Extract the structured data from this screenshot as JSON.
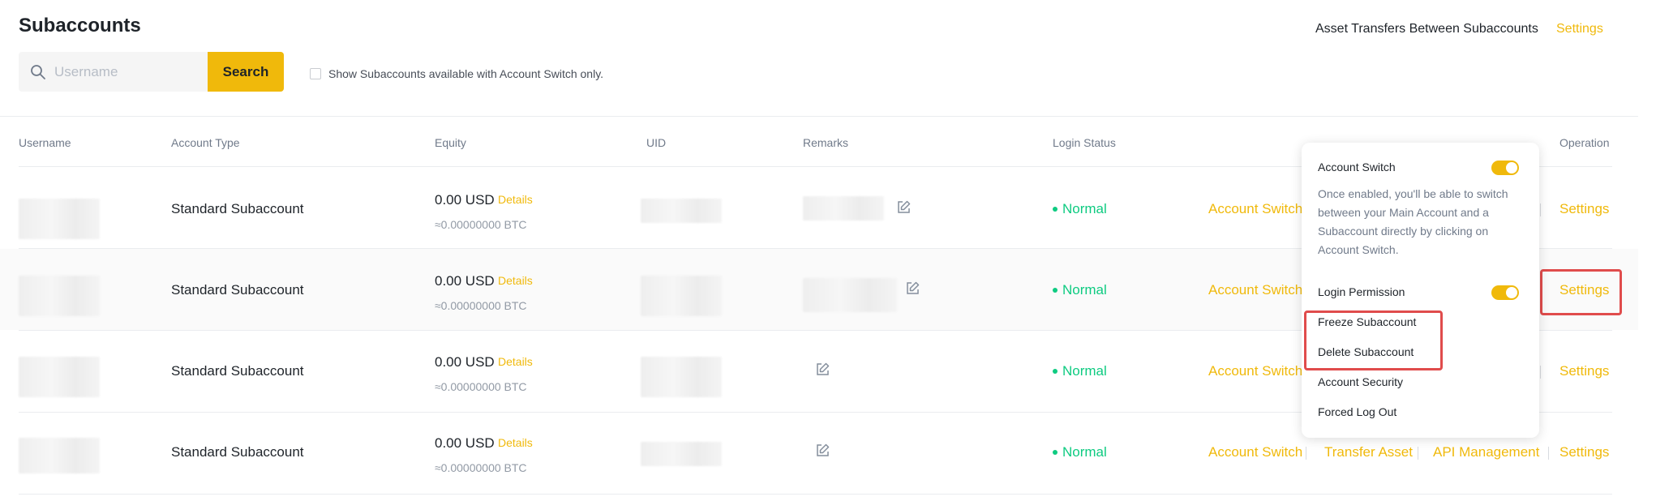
{
  "header": {
    "title": "Subaccounts",
    "transfer_label": "Asset Transfers Between Subaccounts",
    "transfer_settings": "Settings"
  },
  "search": {
    "placeholder": "Username",
    "button_label": "Search",
    "filter_label": "Show Subaccounts available with Account Switch only."
  },
  "table": {
    "columns": [
      "Username",
      "Account Type",
      "Equity",
      "UID",
      "Remarks",
      "Login Status",
      "Operation"
    ],
    "rows": [
      {
        "account_type": "Standard Subaccount",
        "equity": "0.00 USD",
        "details": "Details",
        "btc": "≈0.00000000 BTC",
        "status": "Normal",
        "op_account_switch": "Account Switch",
        "op_settings": "Settings"
      },
      {
        "account_type": "Standard Subaccount",
        "equity": "0.00 USD",
        "details": "Details",
        "btc": "≈0.00000000 BTC",
        "status": "Normal",
        "op_account_switch": "Account Switch",
        "op_settings": "Settings"
      },
      {
        "account_type": "Standard Subaccount",
        "equity": "0.00 USD",
        "details": "Details",
        "btc": "≈0.00000000 BTC",
        "status": "Normal",
        "op_account_switch": "Account Switch",
        "op_settings": "Settings"
      },
      {
        "account_type": "Standard Subaccount",
        "equity": "0.00 USD",
        "details": "Details",
        "btc": "≈0.00000000 BTC",
        "status": "Normal",
        "op_account_switch": "Account Switch",
        "op_transfer": "Transfer Asset",
        "op_api": "API Management",
        "op_settings": "Settings"
      }
    ]
  },
  "popup": {
    "account_switch_label": "Account Switch",
    "account_switch_desc": "Once enabled, you'll be able to switch between your Main Account and a Subaccount directly by clicking on Account Switch.",
    "login_permission_label": "Login Permission",
    "freeze_label": "Freeze Subaccount",
    "delete_label": "Delete Subaccount",
    "security_label": "Account Security",
    "logout_label": "Forced Log Out"
  },
  "colors": {
    "accent": "#f0b90b",
    "status_normal": "#0ecb81",
    "highlight": "#e04c4c"
  },
  "icons": {
    "search": "search-icon",
    "edit": "edit-icon",
    "dot": "status-dot-icon"
  }
}
